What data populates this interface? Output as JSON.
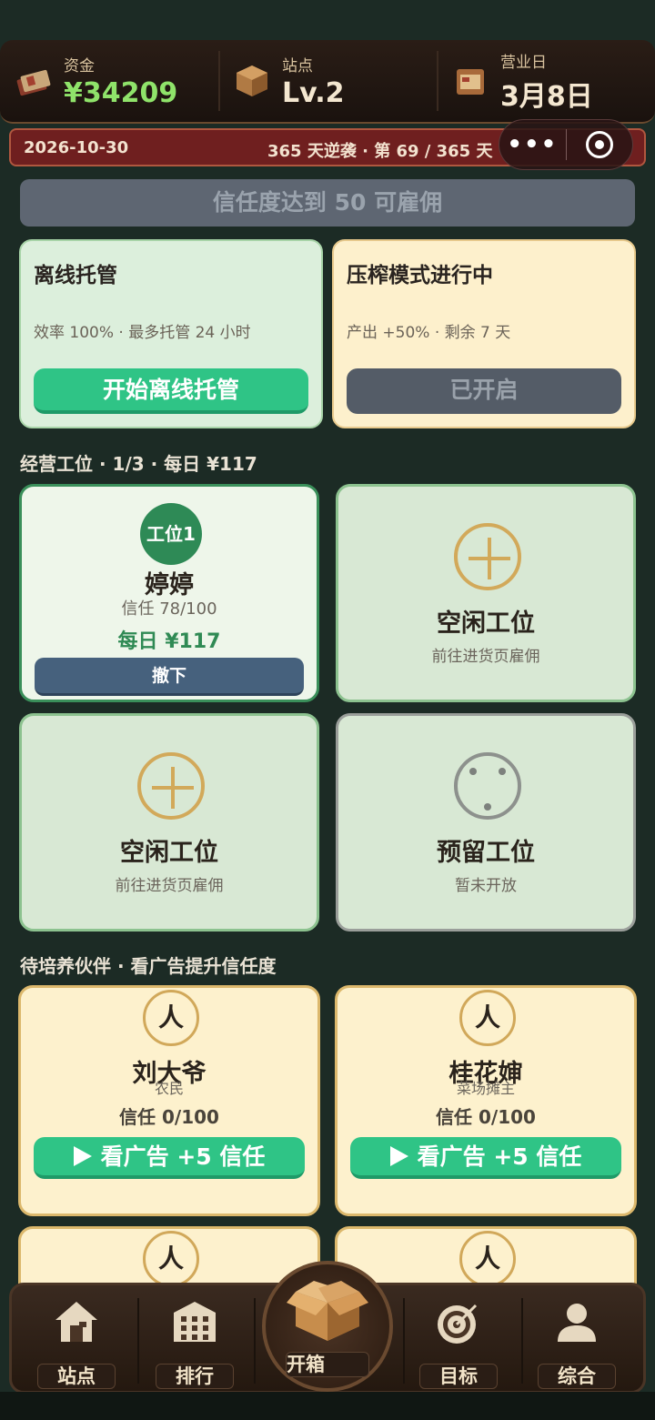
{
  "header": {
    "funds": {
      "label": "资金",
      "value": "¥34209",
      "icon": "money-stack-icon"
    },
    "station": {
      "label": "站点",
      "value": "Lv.2",
      "icon": "box-icon"
    },
    "business_day": {
      "label": "营业日",
      "value": "3月8日",
      "icon": "calendar-box-icon"
    }
  },
  "datebar": {
    "date": "2026-10-30",
    "progress": "365 天逆袭 · 第 69 / 365 天"
  },
  "capsule": {
    "more": "•••"
  },
  "trust_banner": "信任度达到 50 可雇佣",
  "modes": {
    "offline": {
      "title": "离线托管",
      "desc": "效率 100% · 最多托管 24 小时",
      "button": "开始离线托管"
    },
    "squeeze": {
      "title": "压榨模式进行中",
      "desc": "产出 +50% · 剩余 7 天",
      "button": "已开启"
    }
  },
  "stations_section": {
    "title": "经营工位 · 1/3 · 每日 ¥117"
  },
  "slots": [
    {
      "badge": "工位1",
      "name": "婷婷",
      "trust": "信任 78/100",
      "daily": "每日 ¥117",
      "button": "撤下"
    },
    {
      "title": "空闲工位",
      "sub": "前往进货页雇佣"
    },
    {
      "title": "空闲工位",
      "sub": "前往进货页雇佣"
    },
    {
      "title": "预留工位",
      "sub": "暂未开放"
    }
  ],
  "partners_section": {
    "title": "待培养伙伴 · 看广告提升信任度"
  },
  "partners": [
    {
      "avatar": "人",
      "name": "刘大爷",
      "job": "农民",
      "trust": "信任 0/100",
      "button": "看广告 +5 信任"
    },
    {
      "avatar": "人",
      "name": "桂花婶",
      "job": "菜场摊主",
      "trust": "信任 0/100",
      "button": "看广告 +5 信任"
    },
    {
      "avatar": "人"
    },
    {
      "avatar": "人"
    }
  ],
  "nav": {
    "station": {
      "label": "站点",
      "icon": "house-icon"
    },
    "ranking": {
      "label": "排行",
      "icon": "building-icon"
    },
    "open_box": {
      "label": "开箱",
      "icon": "open-box-icon"
    },
    "goal": {
      "label": "目标",
      "icon": "target-icon"
    },
    "general": {
      "label": "综合",
      "icon": "person-icon"
    }
  },
  "colors": {
    "background": "#1c2b25",
    "funds_green": "#8fe36a",
    "button_green": "#2fc486",
    "slot_green": "#2e8a56",
    "datebar_red": "#6f1f1f",
    "card_cream": "#fdf1cd"
  }
}
